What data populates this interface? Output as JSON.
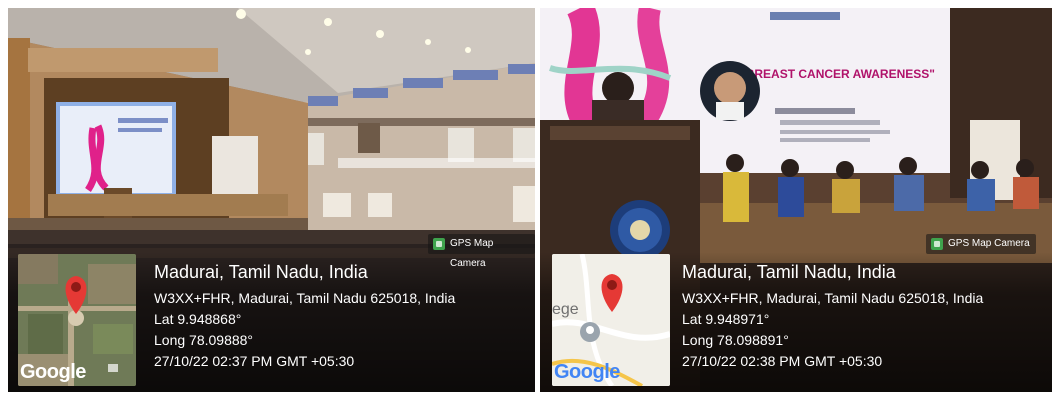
{
  "left": {
    "stamp_app": "GPS Map Camera",
    "place": "Madurai, Tamil Nadu, India",
    "address": "W3XX+FHR, Madurai, Tamil Nadu 625018, India",
    "lat": "Lat 9.948868°",
    "long": "Long 78.09888°",
    "datetime": "27/10/22 02:37 PM GMT +05:30",
    "map_logo": "Google"
  },
  "right": {
    "stamp_app": "GPS Map Camera",
    "place": "Madurai, Tamil Nadu, India",
    "address": "W3XX+FHR, Madurai, Tamil Nadu 625018, India",
    "lat": "Lat 9.948971°",
    "long": "Long 78.098891°",
    "datetime": "27/10/22 02:38 PM GMT +05:30",
    "map_logo": "Google",
    "map_fragment": "ege",
    "screen_title": "\"BREAST CANCER AWARENESS\""
  },
  "colors": {
    "pin": "#e53935",
    "ribbon": "#e0218a",
    "map_satellite": "#6f7a57",
    "map_road": "#f1efe8"
  }
}
